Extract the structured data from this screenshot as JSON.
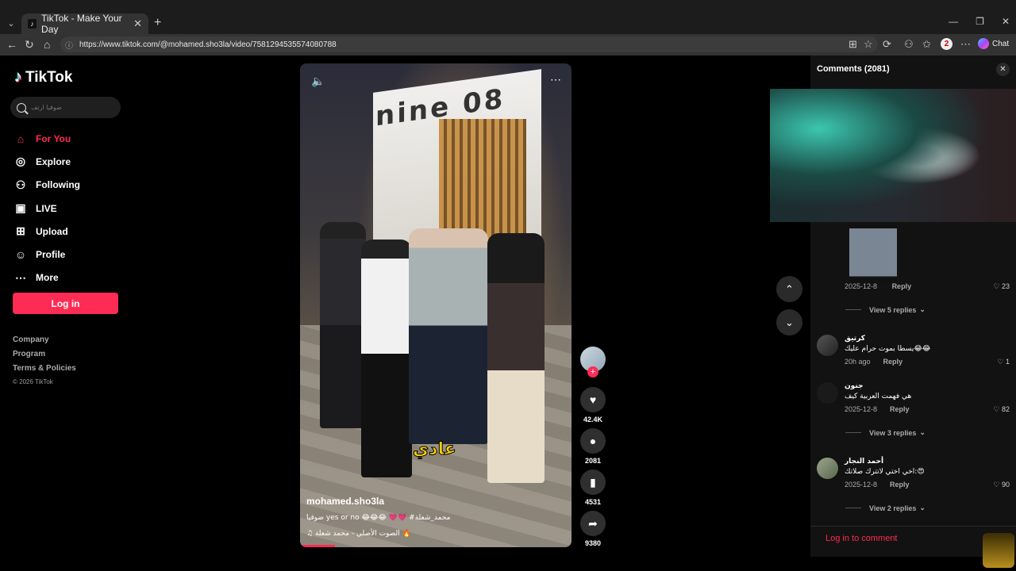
{
  "browser": {
    "tab_title": "TikTok - Make Your Day",
    "url": "https://www.tiktok.com/@mohamed.sho3la/video/7581294535574080788",
    "profile_initial": "2",
    "chat_label": "Chat"
  },
  "sidebar": {
    "logo_text": "TikTok",
    "search_placeholder": "ضوقيا ارتف",
    "items": [
      {
        "label": "For You",
        "icon": "home-icon",
        "active": true
      },
      {
        "label": "Explore",
        "icon": "compass-icon",
        "active": false
      },
      {
        "label": "Following",
        "icon": "user-plus-icon",
        "active": false
      },
      {
        "label": "LIVE",
        "icon": "live-icon",
        "active": false
      },
      {
        "label": "Upload",
        "icon": "upload-icon",
        "active": false
      },
      {
        "label": "Profile",
        "icon": "user-icon",
        "active": false
      },
      {
        "label": "More",
        "icon": "more-icon",
        "active": false
      }
    ],
    "login_label": "Log in",
    "footer": [
      "Company",
      "Program",
      "Terms & Policies"
    ],
    "copyright": "© 2026 TikTok"
  },
  "video": {
    "author": "mohamed.sho3la",
    "description": "ضوقيا yes or no 😂😂😂 💗💗 #محمد_شعلة",
    "music": "♫ الصوت الأصلي - محمد شعلة 🔥",
    "overlay_caption": "عادي",
    "building_text": "nine 08",
    "progress": 0.13
  },
  "actions": {
    "likes": "42.4K",
    "comments": "2081",
    "saves": "4531",
    "shares": "9380"
  },
  "comments": {
    "title": "Comments",
    "count": "(2081)",
    "first": {
      "date": "2025-12-8",
      "reply": "Reply",
      "likes": "23",
      "view_replies": "View 5 replies"
    },
    "list": [
      {
        "name": "كرتيق",
        "text": "يسطا بموت حرام عليك😂😂",
        "date": "20h ago",
        "reply": "Reply",
        "likes": "1"
      },
      {
        "name": "جنون",
        "text": "هي فهمت العربية كيف",
        "date": "2025-12-8",
        "reply": "Reply",
        "likes": "82",
        "view_replies": "View 3 replies"
      },
      {
        "name": "أحمد النجار",
        "text": "اخي اختي لاتترك صلاتك:😍",
        "date": "2025-12-8",
        "reply": "Reply",
        "likes": "90",
        "view_replies": "View 2 replies"
      }
    ],
    "login_prompt": "Log in to comment"
  },
  "watermark": "RAAD"
}
